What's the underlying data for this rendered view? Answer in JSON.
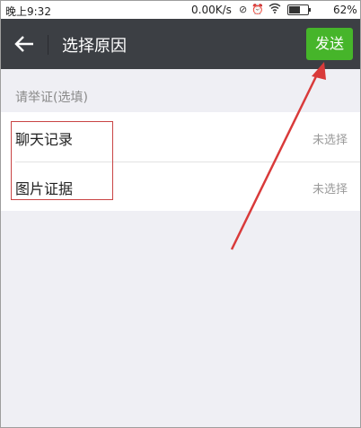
{
  "status_bar": {
    "time": "晚上9:32",
    "network_speed": "0.00K/s",
    "battery": "62%",
    "battery_level": 0.62,
    "icons": [
      "no-sync-icon",
      "alarm-icon",
      "wifi-icon",
      "battery-icon"
    ]
  },
  "nav": {
    "title": "选择原因",
    "send_label": "发送",
    "back_icon": "back-arrow-icon"
  },
  "section": {
    "header": "请举证(选填)",
    "items": [
      {
        "label": "聊天记录",
        "value": "未选择"
      },
      {
        "label": "图片证据",
        "value": "未选择"
      }
    ]
  },
  "colors": {
    "navbar": "#3c3f44",
    "send_button": "#46b52a",
    "annotation": "#d93a3a",
    "background": "#efeff4"
  }
}
